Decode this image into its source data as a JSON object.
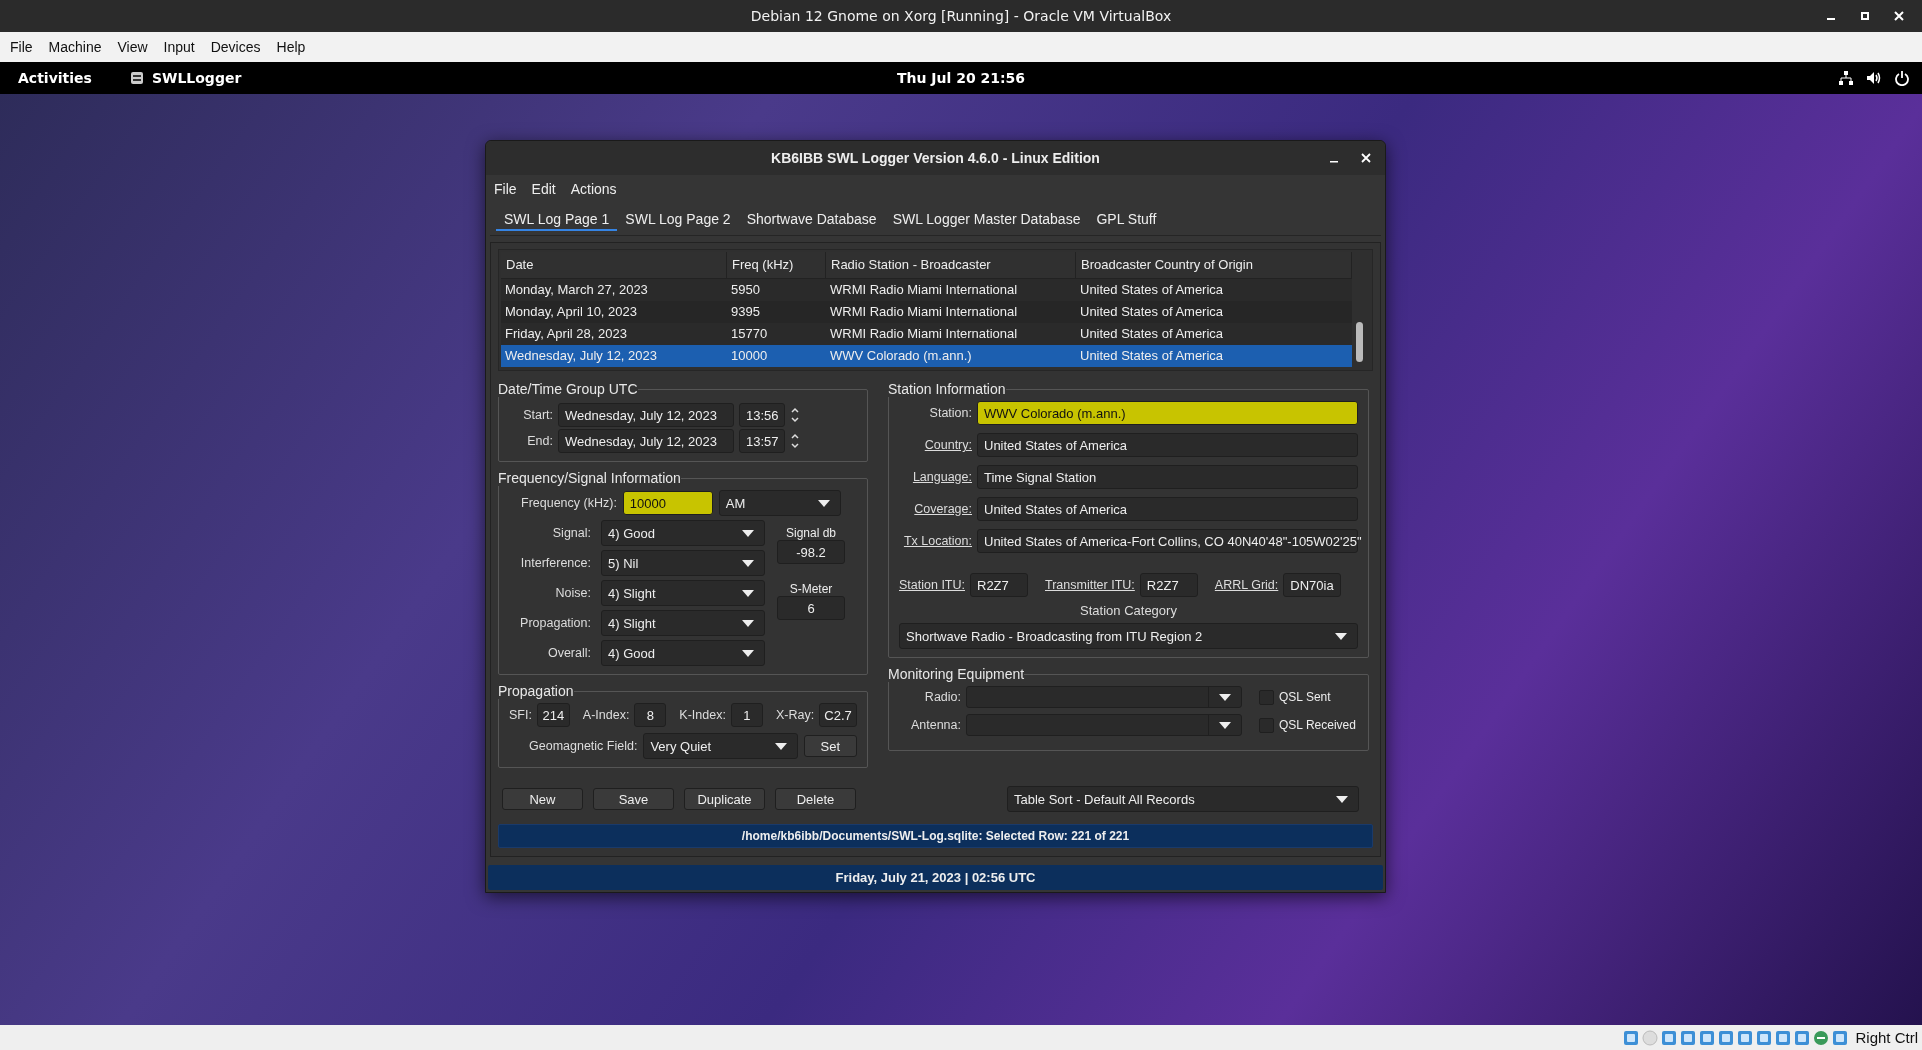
{
  "vm_window": {
    "title": "Debian 12 Gnome on Xorg [Running] - Oracle VM VirtualBox"
  },
  "vm_menu": [
    "File",
    "Machine",
    "View",
    "Input",
    "Devices",
    "Help"
  ],
  "gnome_bar": {
    "activities": "Activities",
    "app": "SWLLogger",
    "clock": "Thu Jul 20  21:56"
  },
  "app": {
    "title": "KB6IBB SWL Logger Version 4.6.0 - Linux Edition",
    "menu": [
      "File",
      "Edit",
      "Actions"
    ],
    "tabs": [
      {
        "label": "SWL Log Page 1",
        "selected": true
      },
      {
        "label": "SWL Log Page 2",
        "selected": false
      },
      {
        "label": "Shortwave Database",
        "selected": false
      },
      {
        "label": "SWL Logger Master Database",
        "selected": false
      },
      {
        "label": "GPL Stuff",
        "selected": false
      }
    ],
    "table": {
      "columns": [
        "Date",
        "Freq (kHz)",
        "Radio Station - Broadcaster",
        "Broadcaster Country of Origin"
      ],
      "rows": [
        {
          "cells": [
            "Monday, March 27, 2023",
            "5950",
            "WRMI Radio Miami International",
            "United States of America"
          ],
          "selected": false
        },
        {
          "cells": [
            "Monday, April 10, 2023",
            "9395",
            "WRMI Radio Miami International",
            "United States of America"
          ],
          "selected": false
        },
        {
          "cells": [
            "Friday, April 28, 2023",
            "15770",
            "WRMI Radio Miami International",
            "United States of America"
          ],
          "selected": false
        },
        {
          "cells": [
            "Wednesday, July 12, 2023",
            "10000",
            "WWV Colorado (m.ann.)",
            "United States of America"
          ],
          "selected": true
        }
      ]
    },
    "datetime": {
      "title": "Date/Time Group UTC",
      "rows": [
        {
          "label": "Start:",
          "date": "Wednesday, July 12, 2023",
          "time": "13:56"
        },
        {
          "label": "End:",
          "date": "Wednesday, July 12, 2023",
          "time": "13:57"
        }
      ]
    },
    "frequency": {
      "title": "Frequency/Signal Information",
      "freq_label": "Frequency (kHz):",
      "freq_value": "10000",
      "freq_highlighted": true,
      "mode": "AM",
      "fields": [
        {
          "label": "Signal:",
          "value": "4) Good"
        },
        {
          "label": "Interference:",
          "value": "5) Nil"
        },
        {
          "label": "Noise:",
          "value": "4) Slight"
        },
        {
          "label": "Propagation:",
          "value": "4) Slight"
        },
        {
          "label": "Overall:",
          "value": "4) Good"
        }
      ],
      "readouts": [
        {
          "label": "Signal db",
          "value": "-98.2"
        },
        {
          "label": "S-Meter",
          "value": "6"
        }
      ]
    },
    "propagation": {
      "title": "Propagation",
      "indices": [
        {
          "label": "SFI:",
          "value": "214"
        },
        {
          "label": "A-Index:",
          "value": "8"
        },
        {
          "label": "K-Index:",
          "value": "1"
        },
        {
          "label": "X-Ray:",
          "value": "C2.7"
        }
      ],
      "geomag_label": "Geomagnetic Field:",
      "geomag_value": "Very Quiet",
      "set_button": "Set"
    },
    "station": {
      "title": "Station Information",
      "fields": [
        {
          "label": "Station:",
          "value": "WWV Colorado (m.ann.)",
          "underlined": false,
          "highlighted": true
        },
        {
          "label": "Country:",
          "value": "United States of America",
          "underlined": true,
          "highlighted": false
        },
        {
          "label": "Language:",
          "value": "Time Signal Station",
          "underlined": true,
          "highlighted": false
        },
        {
          "label": "Coverage:",
          "value": "United States of America",
          "underlined": true,
          "highlighted": false
        },
        {
          "label": "Tx Location:",
          "value": "United States of America-Fort Collins, CO 40N40'48\"-105W02'25\"",
          "underlined": true,
          "highlighted": false
        }
      ],
      "itu": [
        {
          "label": "Station ITU:",
          "value": "R2Z7"
        },
        {
          "label": "Transmitter ITU:",
          "value": "R2Z7"
        },
        {
          "label": "ARRL Grid:",
          "value": "DN70ia"
        }
      ],
      "category_title": "Station Category",
      "category": "Shortwave Radio - Broadcasting from ITU Region 2"
    },
    "equipment": {
      "title": "Monitoring Equipment",
      "rows": [
        {
          "label": "Radio:",
          "check": {
            "label": "QSL Sent",
            "checked": false
          }
        },
        {
          "label": "Antenna:",
          "check": {
            "label": "QSL Received",
            "checked": false
          }
        }
      ]
    },
    "buttons": [
      "New",
      "Save",
      "Duplicate",
      "Delete"
    ],
    "sort": "Table Sort - Default All Records",
    "status": "/home/kb6ibb/Documents/SWL-Log.sqlite:  Selected Row: 221 of 221",
    "clock_bar": "Friday, July 21, 2023 | 02:56  UTC"
  },
  "vm_status": {
    "host_key": "Right Ctrl"
  }
}
